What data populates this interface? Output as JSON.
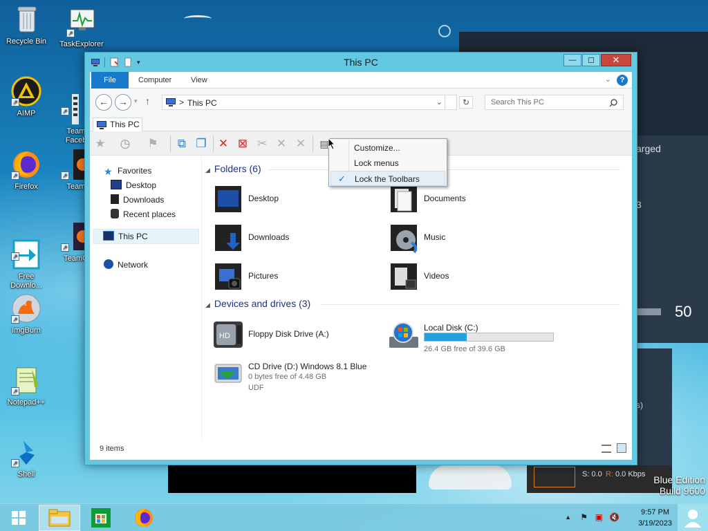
{
  "desktop": {
    "icons": [
      {
        "label": "Recycle Bin",
        "icon": "recycle-bin-icon"
      },
      {
        "label": "TaskExplorer",
        "icon": "task-explorer-icon"
      },
      {
        "label": "AIMP",
        "icon": "aimp-icon"
      },
      {
        "label": "Team\nFaceb",
        "icon": "teamviewer-icon"
      },
      {
        "label": "Firefox",
        "icon": "firefox-icon"
      },
      {
        "label": "Team",
        "icon": "teamviewer-icon"
      },
      {
        "label": "Free\nDownlo...",
        "icon": "free-download-manager-icon"
      },
      {
        "label": "TeamO",
        "icon": "teamviewer-icon"
      },
      {
        "label": "ImgBurn",
        "icon": "imgburn-icon"
      },
      {
        "label": "Notepad++",
        "icon": "notepad-plus-plus-icon"
      },
      {
        "label": "Shell",
        "icon": "shell-icon"
      }
    ],
    "bg_texts": {
      "charged": "arged",
      "three": "3",
      "fifty": "50",
      "net": "S: 0.0",
      "net_r": "R:",
      "net_val": "0.0 Kbps",
      "s_paren": "s)"
    },
    "watermark": {
      "line1": "Blue Edition",
      "line2": "Build 9600"
    }
  },
  "window": {
    "title": "This PC",
    "controls": {
      "minimize": "—",
      "maximize": "☐",
      "close": "✕"
    },
    "ribbon_tabs": {
      "file": "File",
      "computer": "Computer",
      "view": "View"
    },
    "help": "?",
    "address": {
      "path": "This PC",
      "separator": ">"
    },
    "search": {
      "placeholder": "Search This PC"
    },
    "tab": "This PC",
    "nav": {
      "favorites": "Favorites",
      "desktop": "Desktop",
      "downloads": "Downloads",
      "recent": "Recent places",
      "thispc": "This PC",
      "network": "Network"
    },
    "groups": {
      "folders": "Folders (6)",
      "devices": "Devices and drives (3)"
    },
    "folders": [
      "Desktop",
      "Documents",
      "Downloads",
      "Music",
      "Pictures",
      "Videos"
    ],
    "drives": {
      "floppy": {
        "name": "Floppy Disk Drive (A:)"
      },
      "local": {
        "name": "Local Disk (C:)",
        "free": "26.4 GB free of 39.6 GB",
        "used_fraction": 0.33
      },
      "cd": {
        "name": "CD Drive (D:) Windows 8.1 Blue",
        "free": "0 bytes free of 4.48 GB",
        "fs": "UDF"
      }
    },
    "status": "9 items"
  },
  "context_menu": {
    "items": [
      "Customize...",
      "Lock menus",
      "Lock the Toolbars"
    ],
    "checked_mark": "✓"
  },
  "taskbar": {
    "time": "9:57 PM",
    "date": "3/19/2023",
    "tray_up": "▲"
  },
  "colors": {
    "accent": "#1979ca",
    "window_frame": "#63c9e3",
    "close": "#c9463d",
    "group_header": "#1e3287"
  }
}
